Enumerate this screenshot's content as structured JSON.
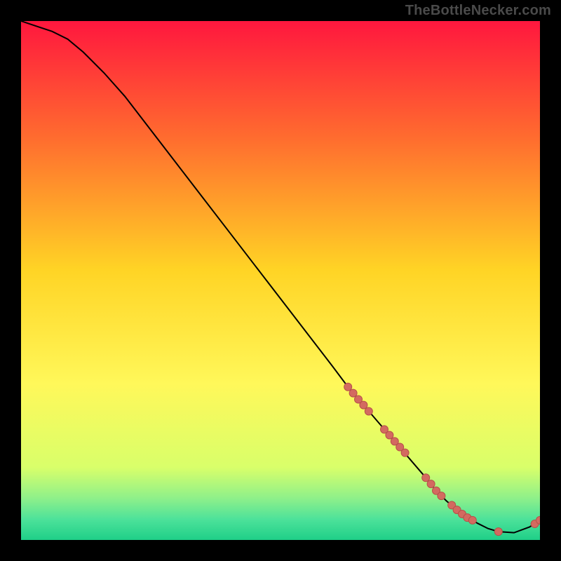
{
  "watermark": "TheBottleNecker.com",
  "colors": {
    "bg_black": "#000000",
    "gradient_top": "#ff173e",
    "gradient_mid_upper": "#ff6a2f",
    "gradient_mid": "#ffd425",
    "gradient_mid_lower": "#fff85a",
    "gradient_lower": "#d9ff6a",
    "gradient_band1": "#8ef08a",
    "gradient_band2": "#4de29a",
    "gradient_bottom": "#1fcf88",
    "curve": "#000000",
    "dot_fill": "#d36a60",
    "dot_stroke": "#b65149"
  },
  "chart_data": {
    "type": "line",
    "title": "",
    "xlabel": "",
    "ylabel": "",
    "xlim": [
      0,
      100
    ],
    "ylim": [
      0,
      100
    ],
    "series": [
      {
        "name": "curve",
        "x": [
          0,
          3,
          6,
          9,
          12,
          16,
          20,
          25,
          30,
          35,
          40,
          45,
          50,
          55,
          60,
          63,
          66,
          69,
          72,
          75,
          78,
          80,
          82,
          85,
          88,
          90,
          92,
          95,
          98,
          100
        ],
        "y": [
          100,
          99,
          98,
          96.5,
          94,
          90,
          85.5,
          79,
          72.5,
          66,
          59.5,
          53,
          46.5,
          40,
          33.5,
          29.5,
          26,
          22.5,
          19,
          15.5,
          12,
          9.5,
          7.5,
          5,
          3.2,
          2.2,
          1.6,
          1.4,
          2.5,
          3.8
        ]
      },
      {
        "name": "dots",
        "x": [
          63,
          64,
          65,
          66,
          67,
          70,
          71,
          72,
          73,
          74,
          78,
          79,
          80,
          81,
          83,
          84,
          85,
          86,
          87,
          92,
          99,
          100
        ],
        "y": [
          29.5,
          28.3,
          27.1,
          26,
          24.8,
          21.3,
          20.2,
          19,
          17.9,
          16.8,
          12,
          10.8,
          9.5,
          8.5,
          6.7,
          5.8,
          5,
          4.3,
          3.8,
          1.6,
          3.1,
          3.8
        ]
      }
    ]
  }
}
